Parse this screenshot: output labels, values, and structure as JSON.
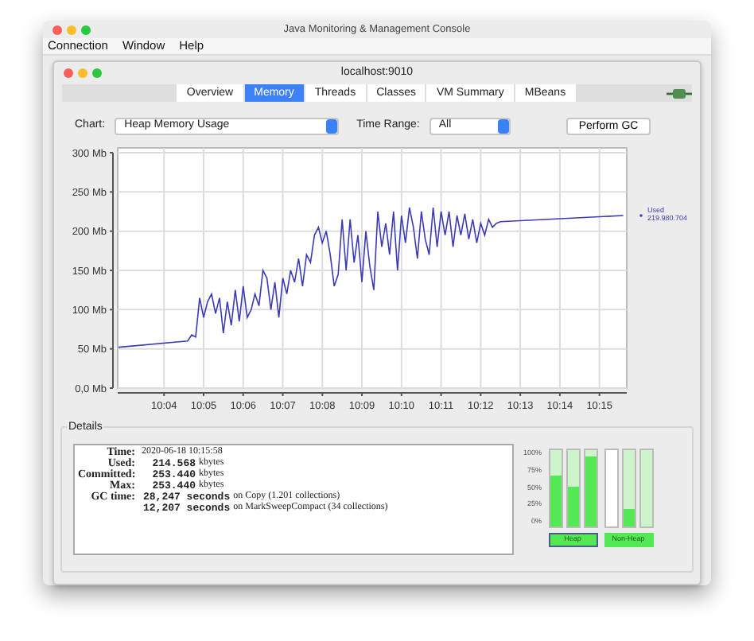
{
  "window": {
    "title": "Java Monitoring & Management Console"
  },
  "menu": [
    "Connection",
    "Window",
    "Help"
  ],
  "connection": {
    "title": "localhost:9010",
    "connected": true
  },
  "tabs": [
    {
      "label": "Overview",
      "selected": false
    },
    {
      "label": "Memory",
      "selected": true
    },
    {
      "label": "Threads",
      "selected": false
    },
    {
      "label": "Classes",
      "selected": false
    },
    {
      "label": "VM Summary",
      "selected": false
    },
    {
      "label": "MBeans",
      "selected": false
    }
  ],
  "toolbar": {
    "chart_label": "Chart:",
    "chart_value": "Heap Memory Usage",
    "range_label": "Time Range:",
    "range_value": "All",
    "button": "Perform GC"
  },
  "chart": {
    "legend_value": "219.980.704",
    "chart_data": {
      "type": "line",
      "grid": true,
      "xlim": [
        602.83,
        615.69
      ],
      "ylim": [
        0,
        300
      ],
      "xticks": [
        {
          "value": 604,
          "label": "10:04"
        },
        {
          "value": 605,
          "label": "10:05"
        },
        {
          "value": 606,
          "label": "10:06"
        },
        {
          "value": 607,
          "label": "10:07"
        },
        {
          "value": 608,
          "label": "10:08"
        },
        {
          "value": 609,
          "label": "10:09"
        },
        {
          "value": 610,
          "label": "10:10"
        },
        {
          "value": 611,
          "label": "10:11"
        },
        {
          "value": 612,
          "label": "10:12"
        },
        {
          "value": 613,
          "label": "10:13"
        },
        {
          "value": 614,
          "label": "10:14"
        },
        {
          "value": 615,
          "label": "10:15"
        }
      ],
      "yticks": [
        {
          "value": 0,
          "label": "0,0 Mb"
        },
        {
          "value": 50,
          "label": "50 Mb"
        },
        {
          "value": 100,
          "label": "100 Mb"
        },
        {
          "value": 150,
          "label": "150 Mb"
        },
        {
          "value": 200,
          "label": "200 Mb"
        },
        {
          "value": 250,
          "label": "250 Mb"
        },
        {
          "value": 300,
          "label": "300 Mb"
        }
      ],
      "x": [
        602.85,
        604.6,
        604.7,
        604.8,
        604.9,
        605.0,
        605.1,
        605.2,
        605.3,
        605.4,
        605.5,
        605.6,
        605.7,
        605.8,
        605.9,
        606.0,
        606.1,
        606.2,
        606.3,
        606.4,
        606.5,
        606.6,
        606.7,
        606.8,
        606.9,
        607.0,
        607.1,
        607.2,
        607.3,
        607.4,
        607.5,
        607.6,
        607.7,
        607.8,
        607.9,
        608.0,
        608.1,
        608.2,
        608.3,
        608.4,
        608.5,
        608.6,
        608.7,
        608.8,
        608.9,
        609.0,
        609.1,
        609.2,
        609.3,
        609.4,
        609.5,
        609.6,
        609.7,
        609.8,
        609.9,
        610.0,
        610.1,
        610.2,
        610.3,
        610.4,
        610.5,
        610.6,
        610.7,
        610.8,
        610.9,
        611.0,
        611.1,
        611.2,
        611.3,
        611.4,
        611.5,
        611.6,
        611.7,
        611.8,
        611.9,
        612.0,
        612.1,
        612.2,
        612.3,
        612.4,
        612.5,
        615.6
      ],
      "series": [
        {
          "name": "Used",
          "color": "#3b3bb8",
          "values": [
            52,
            60,
            68,
            65,
            115,
            90,
            110,
            120,
            95,
            115,
            70,
            110,
            80,
            125,
            85,
            130,
            90,
            100,
            120,
            105,
            150,
            140,
            100,
            135,
            90,
            140,
            120,
            150,
            135,
            165,
            130,
            170,
            160,
            195,
            205,
            185,
            200,
            170,
            130,
            145,
            215,
            150,
            215,
            160,
            195,
            135,
            200,
            155,
            125,
            225,
            180,
            210,
            170,
            225,
            150,
            220,
            185,
            230,
            205,
            165,
            225,
            190,
            170,
            230,
            180,
            225,
            195,
            225,
            180,
            220,
            195,
            222,
            190,
            215,
            185,
            210,
            195,
            215,
            205,
            210,
            212,
            220
          ]
        }
      ]
    }
  },
  "details": {
    "title": "Details",
    "rows": [
      {
        "label": "Time:",
        "value": "2020-06-18 10:15:58",
        "kind": "plain"
      },
      {
        "label": "Used:",
        "value": "214.568",
        "unit": "kbytes",
        "kind": "number"
      },
      {
        "label": "Committed:",
        "value": "253.440",
        "unit": "kbytes",
        "kind": "number"
      },
      {
        "label": "Max:",
        "value": "253.440",
        "unit": "kbytes",
        "kind": "number"
      },
      {
        "label": "GC time:",
        "value": "28,247 seconds",
        "unit": "on Copy (1.201 collections)",
        "kind": "number"
      },
      {
        "value": "12,207 seconds",
        "unit": "on MarkSweepCompact (34 collections)",
        "kind": "number"
      }
    ]
  },
  "meters": {
    "scale": [
      "100%",
      "75%",
      "50%",
      "25%",
      "0%"
    ],
    "groups": [
      {
        "label": "Heap",
        "selected": true,
        "bars": [
          {
            "level": 0.67,
            "committed": true
          },
          {
            "level": 0.52,
            "committed": true
          },
          {
            "level": 0.92,
            "committed": true
          }
        ]
      },
      {
        "label": "Non-Heap",
        "selected": false,
        "bars": [
          {
            "committed": false
          },
          {
            "level": 0.22,
            "committed": true
          },
          {
            "committed": true
          }
        ]
      }
    ]
  }
}
